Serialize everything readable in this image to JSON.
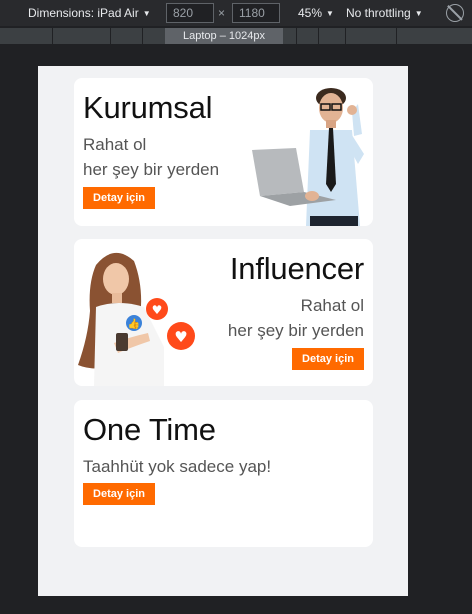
{
  "toolbar": {
    "dimensions_label": "Dimensions: iPad Air",
    "width": "820",
    "height": "1180",
    "times": "×",
    "zoom": "45%",
    "throttling": "No throttling"
  },
  "media_query": {
    "label": "Laptop – 1024px"
  },
  "cards": [
    {
      "title": "Kurumsal",
      "subtitle_line1": "Rahat ol",
      "subtitle_line2": "her şey bir yerden",
      "button": "Detay için"
    },
    {
      "title": "Influencer",
      "subtitle_line1": "Rahat ol",
      "subtitle_line2": "her şey bir yerden",
      "button": "Detay için"
    },
    {
      "title": "One Time",
      "subtitle_line1": "Taahhüt yok sadece yap!",
      "button": "Detay için"
    }
  ],
  "colors": {
    "accent": "#ff6a00",
    "page_bg": "#f1f2f4",
    "chrome_bg": "#292a2d"
  }
}
